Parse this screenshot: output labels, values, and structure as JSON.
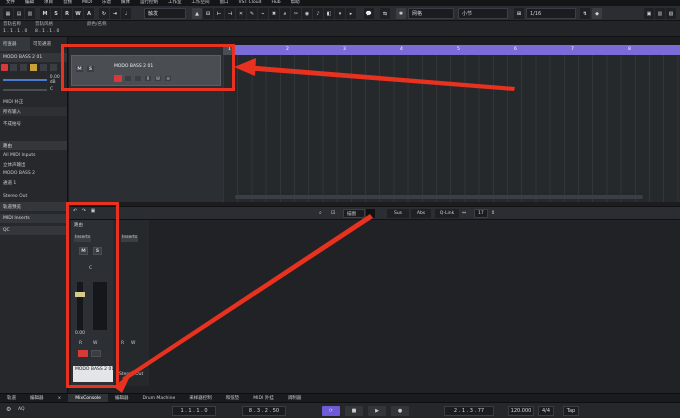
{
  "menubar": {
    "items": [
      "文件",
      "编辑",
      "项目",
      "音频",
      "MIDI",
      "乐谱",
      "媒体",
      "运行控制",
      "工作室",
      "工作空间",
      "窗口",
      "VST Cloud",
      "Hub",
      "帮助"
    ]
  },
  "toolbar": {
    "modes": [
      "M",
      "S",
      "R",
      "W",
      "A"
    ],
    "snap_label": "触发",
    "grid_type": "网格",
    "grid_value": "小节",
    "quantize": "1/16"
  },
  "infoline": {
    "col1_label": "音轨名称",
    "col2_label": "音轨风格",
    "col3_label": "颜色/名称",
    "value1": "1 . 1 . 1 . 0",
    "value2": "8 . 1 . 1 . 0"
  },
  "inspector": {
    "tab1": "检查器",
    "tab2": "可见通道",
    "track_name": "MODO BASS 2 01",
    "midi_modifiers": "MIDI 补正",
    "midi_inserts": "MIDI Inserts",
    "all_midi_inputs": "All MIDI Inputs",
    "instrument": "MODO BASS 2",
    "channel": "通道 1",
    "stereo_out": "Stereo Out",
    "sec_midi_inserts": "MIDI Inserts",
    "sec_qc": "QC",
    "sec_visibility": "轨道预览",
    "row_fader": "0.00 dB",
    "row_pan": "C",
    "row_input": "所有输入",
    "row_audio_out": "立体声输出",
    "row_tempo": "不成拍号"
  },
  "tracklist": {
    "folder_label": "输入通道",
    "track_name": "MODO BASS 2 01",
    "buttons": [
      "M",
      "S"
    ],
    "row2_buttons": [
      "●",
      "◁",
      "◐",
      "R",
      "W",
      "☰"
    ]
  },
  "ruler": {
    "bars": [
      "1",
      "2",
      "3",
      "4",
      "5",
      "6",
      "7",
      "8"
    ]
  },
  "lowerbar": {
    "grid": "描图",
    "sus": "Sus",
    "abs": "Abs",
    "qlink": "Q-Link",
    "value": "17"
  },
  "mixer": {
    "routing_label": "路由",
    "inserts_label": "Inserts",
    "ms": [
      "M",
      "S"
    ],
    "rw": [
      "R",
      "W"
    ],
    "level": "0.00",
    "pan": "C",
    "channel_name": "MODO BASS 2 01",
    "stereo_out": "Stereo Out",
    "chan2_rw": [
      "R",
      "W"
    ]
  },
  "bottomtabs": [
    "轨道",
    "编辑器",
    "MixConsole",
    "编辑器",
    "Drum Machine",
    "采样器控制",
    "和弦垫",
    "MIDI 外挂",
    "调制器"
  ],
  "transport": {
    "mode_label": "AQ",
    "left_locator": "1 . 1 . 1 . 0",
    "right_locator": "8 . 3 . 2 . 50",
    "position": "2 . 1 . 3 . 77",
    "tempo": "120.000",
    "signature": "4/4",
    "tap": "Tap"
  },
  "colors": {
    "ruler": "#7a6bd9",
    "record": "#d83a3a",
    "annotation": "#e8321f",
    "active_tab": "#2f3236"
  }
}
